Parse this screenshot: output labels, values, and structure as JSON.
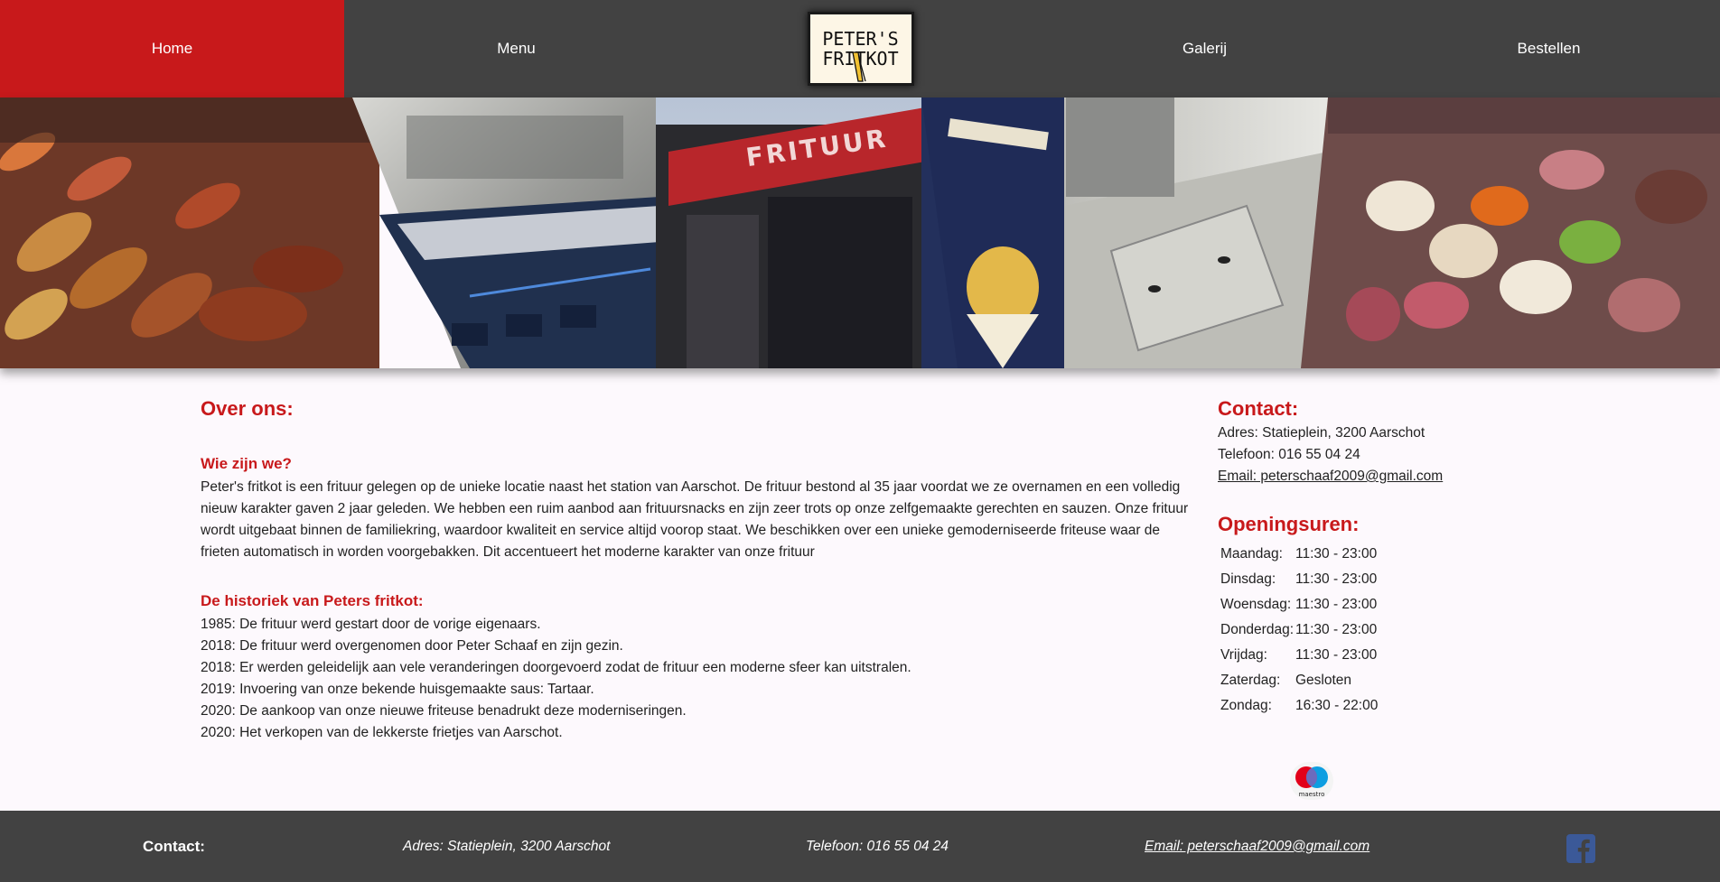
{
  "nav": {
    "items": [
      {
        "label": "Home",
        "active": true
      },
      {
        "label": "Menu",
        "active": false
      },
      {
        "label": "Galerij",
        "active": false
      },
      {
        "label": "Bestellen",
        "active": false
      }
    ],
    "logo_line1": "PETER'S",
    "logo_line2": "FRITKOT"
  },
  "banner": {
    "sign_text": "FRITUUR"
  },
  "about": {
    "title": "Over ons:",
    "who_title": "Wie zijn we?",
    "who_text": "Peter's fritkot is een frituur gelegen op de unieke locatie naast het station van Aarschot. De frituur bestond al 35 jaar voordat we ze overnamen en een volledig nieuw karakter gaven 2 jaar geleden. We hebben een ruim aanbod aan frituursnacks en zijn zeer trots op onze zelfgemaakte gerechten en sauzen. Onze frituur wordt uitgebaat binnen de familiekring, waardoor kwaliteit en service altijd voorop staat. We beschikken over een unieke gemoderniseerde friteuse waar de frieten automatisch in worden voorgebakken. Dit accentueert het moderne karakter van onze frituur",
    "history_title": "De historiek van Peters fritkot:",
    "history": [
      "1985: De frituur werd gestart door de vorige eigenaars.",
      "2018: De frituur werd overgenomen door Peter Schaaf en zijn gezin.",
      "2018: Er werden geleidelijk aan vele veranderingen doorgevoerd zodat de frituur een moderne sfeer kan uitstralen.",
      "2019: Invoering van onze bekende huisgemaakte saus: Tartaar.",
      "2020: De aankoop van onze nieuwe friteuse benadrukt deze moderniseringen.",
      "2020: Het verkopen van de lekkerste frietjes van Aarschot."
    ]
  },
  "contact": {
    "title": "Contact:",
    "address": "Adres: Statieplein, 3200 Aarschot",
    "phone": "Telefoon: 016 55 04 24",
    "email": "Email: peterschaaf2009@gmail.com"
  },
  "hours": {
    "title": "Openingsuren:",
    "rows": [
      {
        "day": "Maandag:",
        "time": "11:30 - 23:00"
      },
      {
        "day": "Dinsdag:",
        "time": "11:30 - 23:00"
      },
      {
        "day": "Woensdag:",
        "time": "11:30 - 23:00"
      },
      {
        "day": "Donderdag:",
        "time": "11:30 - 23:00"
      },
      {
        "day": "Vrijdag:",
        "time": "11:30 - 23:00"
      },
      {
        "day": "Zaterdag:",
        "time": "Gesloten"
      },
      {
        "day": "Zondag:",
        "time": "16:30 - 22:00"
      }
    ]
  },
  "payment": {
    "label": "maestro"
  },
  "footer": {
    "title": "Contact:",
    "address": "Adres: Statieplein, 3200 Aarschot",
    "phone": "Telefoon: 016 55 04 24",
    "email": "Email: peterschaaf2009@gmail.com"
  },
  "colors": {
    "brand_red": "#c8191b",
    "nav_bg": "#424242",
    "page_bg": "#fdf9fd"
  },
  "icons": {
    "social": "facebook-icon",
    "payment": "maestro-icon"
  }
}
